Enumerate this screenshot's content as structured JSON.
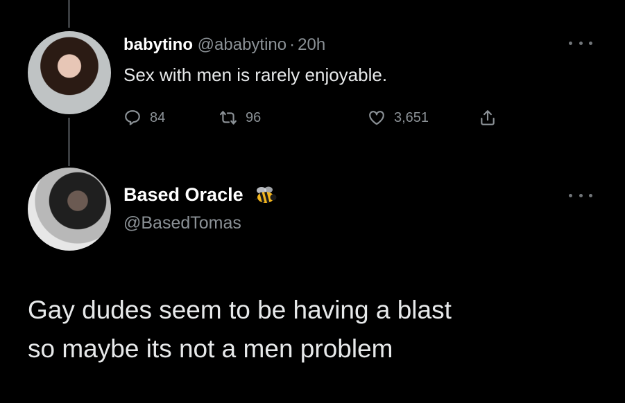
{
  "tweet1": {
    "display_name": "babytino",
    "handle": "@ababytino",
    "separator": "·",
    "time": "20h",
    "text": "Sex with men is rarely enjoyable.",
    "reply_count": "84",
    "retweet_count": "96",
    "like_count": "3,651"
  },
  "tweet2": {
    "display_name": "Based Oracle",
    "handle": "@BasedTomas",
    "text_line1": "Gay dudes seem to be having a blast",
    "text_line2": "so maybe its not a men problem"
  },
  "icons": {
    "reply": "reply-icon",
    "retweet": "retweet-icon",
    "like": "heart-icon",
    "share": "share-icon",
    "more": "more-icon",
    "badge": "bee-icon"
  },
  "colors": {
    "background": "#000000",
    "primary_text": "#e7e9ea",
    "secondary_text": "#8b9196",
    "thread_line": "#3a3d40"
  }
}
